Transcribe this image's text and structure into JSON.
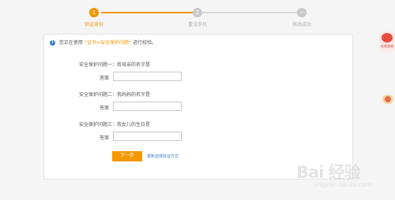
{
  "steps": [
    {
      "number": "1",
      "label": "验证身份"
    },
    {
      "number": "2",
      "label": "重设手机"
    },
    {
      "number": "✓",
      "label": "修改成功"
    }
  ],
  "notice": {
    "prefix": "您正在使用",
    "highlight": "“证书+安全保护问题”",
    "suffix": "进行校验。"
  },
  "questions": [
    {
      "label": "安全保护问题一：我母亲的名字是",
      "answer_label": "答案",
      "answer_value": ""
    },
    {
      "label": "安全保护问题二：我妈妈的名字是",
      "answer_label": "答案",
      "answer_value": ""
    },
    {
      "label": "安全保护问题三：我女儿的生日是",
      "answer_label": "答案",
      "answer_value": ""
    }
  ],
  "actions": {
    "next_label": "下一步",
    "reselect_label": "重新选择验证方式"
  },
  "side": {
    "online_service_label": "在线咨询"
  },
  "watermark": {
    "main": "Bai 经验",
    "sub": "jingyan.baidu.com"
  },
  "colors": {
    "accent": "#f39800",
    "link": "#3a7fd5",
    "info": "#3a7fd5"
  }
}
